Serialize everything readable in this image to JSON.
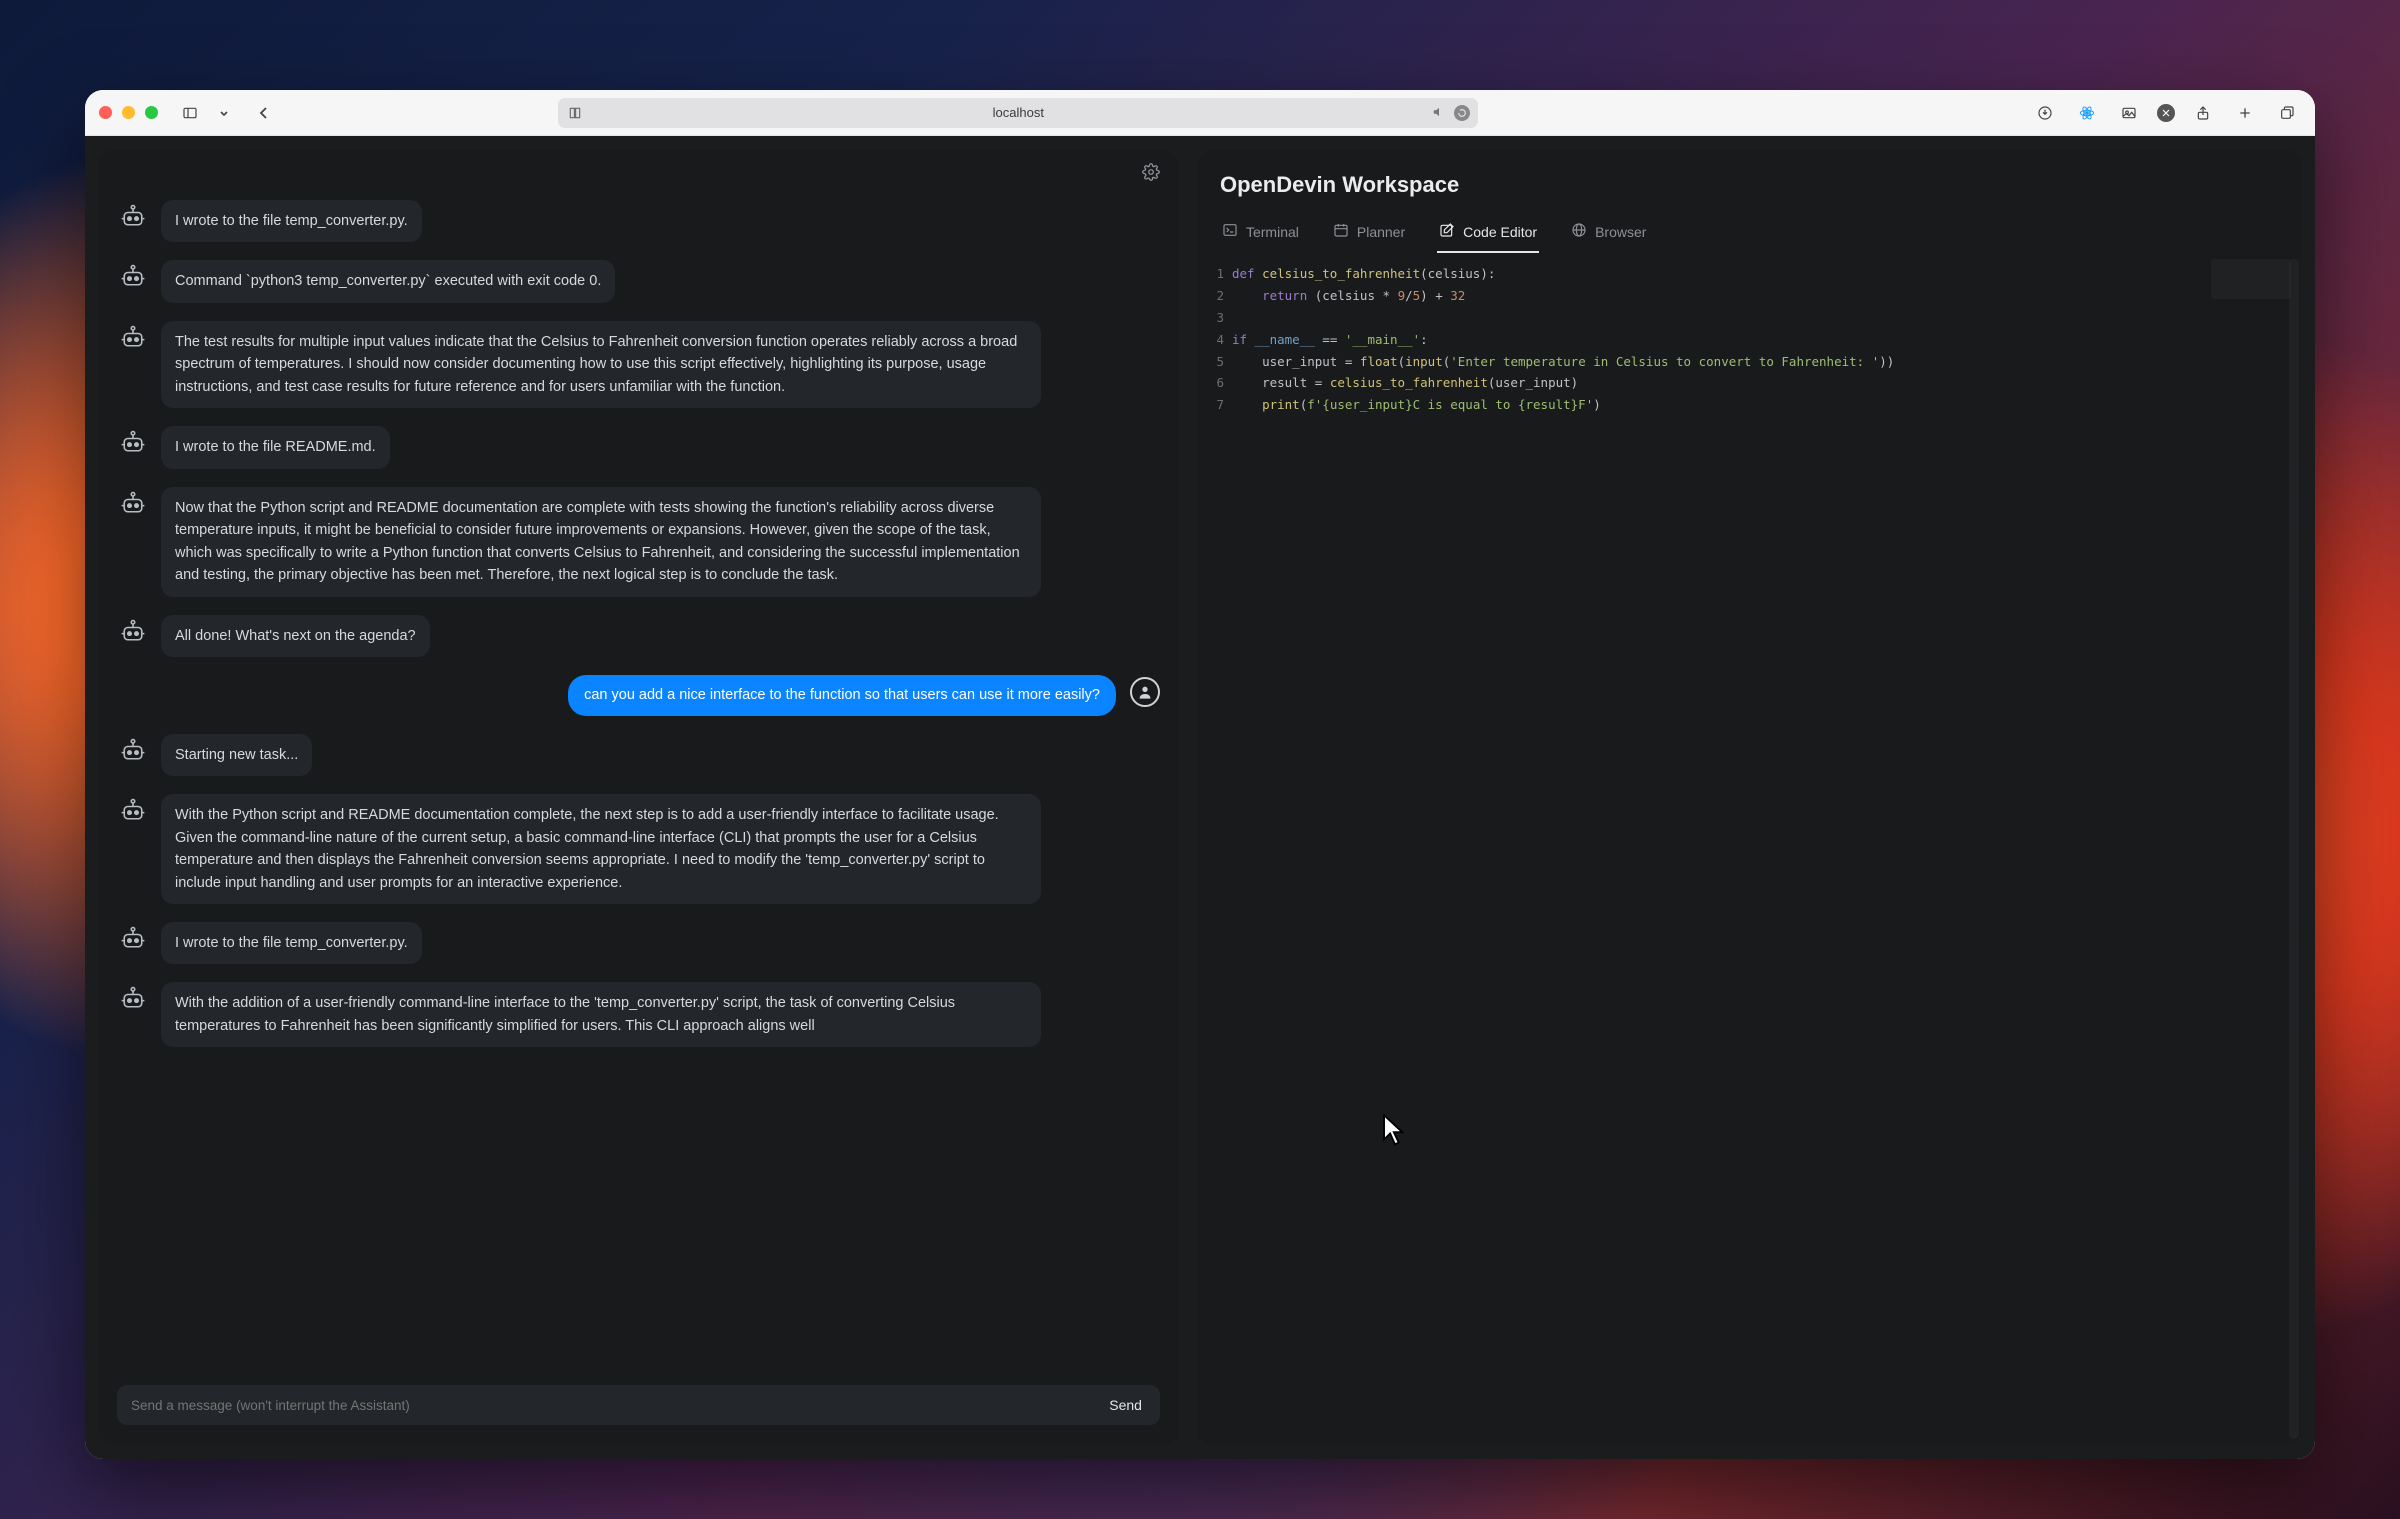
{
  "browser": {
    "url_label": "localhost"
  },
  "chat": {
    "messages": [
      {
        "role": "bot",
        "text": "I wrote to the file temp_converter.py."
      },
      {
        "role": "bot",
        "text": "Command `python3 temp_converter.py` executed with exit code 0."
      },
      {
        "role": "bot",
        "text": "The test results for multiple input values indicate that the Celsius to Fahrenheit conversion function operates reliably across a broad spectrum of temperatures. I should now consider documenting how to use this script effectively, highlighting its purpose, usage instructions, and test case results for future reference and for users unfamiliar with the function."
      },
      {
        "role": "bot",
        "text": "I wrote to the file README.md."
      },
      {
        "role": "bot",
        "text": "Now that the Python script and README documentation are complete with tests showing the function's reliability across diverse temperature inputs, it might be beneficial to consider future improvements or expansions. However, given the scope of the task, which was specifically to write a Python function that converts Celsius to Fahrenheit, and considering the successful implementation and testing, the primary objective has been met. Therefore, the next logical step is to conclude the task."
      },
      {
        "role": "bot",
        "text": "All done! What's next on the agenda?"
      },
      {
        "role": "user",
        "text": "can you add a nice interface to the function so that users can use it more easily?"
      },
      {
        "role": "bot",
        "text": "Starting new task..."
      },
      {
        "role": "bot",
        "text": "With the Python script and README documentation complete, the next step is to add a user-friendly interface to facilitate usage. Given the command-line nature of the current setup, a basic command-line interface (CLI) that prompts the user for a Celsius temperature and then displays the Fahrenheit conversion seems appropriate. I need to modify the 'temp_converter.py' script to include input handling and user prompts for an interactive experience."
      },
      {
        "role": "bot",
        "text": "I wrote to the file temp_converter.py."
      },
      {
        "role": "bot",
        "text": "With the addition of a user-friendly command-line interface to the 'temp_converter.py' script, the task of converting Celsius temperatures to Fahrenheit has been significantly simplified for users. This CLI approach aligns well"
      }
    ],
    "composer": {
      "placeholder": "Send a message (won't interrupt the Assistant)",
      "send_label": "Send"
    }
  },
  "workspace": {
    "title": "OpenDevin Workspace",
    "tabs": [
      {
        "id": "terminal",
        "label": "Terminal",
        "icon": "terminal",
        "active": false
      },
      {
        "id": "planner",
        "label": "Planner",
        "icon": "calendar",
        "active": false
      },
      {
        "id": "editor",
        "label": "Code Editor",
        "icon": "pencil-square",
        "active": true
      },
      {
        "id": "browser",
        "label": "Browser",
        "icon": "globe",
        "active": false
      }
    ],
    "code": {
      "line_numbers": [
        "1",
        "2",
        "3",
        "4",
        "5",
        "6",
        "7"
      ],
      "lines": [
        {
          "tokens": [
            {
              "t": "kw",
              "s": "def "
            },
            {
              "t": "fn",
              "s": "celsius_to_fahrenheit"
            },
            {
              "t": "op",
              "s": "(celsius):"
            }
          ]
        },
        {
          "indent": 1,
          "tokens": [
            {
              "t": "kw",
              "s": "return "
            },
            {
              "t": "op",
              "s": "(celsius * "
            },
            {
              "t": "num",
              "s": "9"
            },
            {
              "t": "op",
              "s": "/"
            },
            {
              "t": "num",
              "s": "5"
            },
            {
              "t": "op",
              "s": ") + "
            },
            {
              "t": "num",
              "s": "32"
            }
          ]
        },
        {
          "tokens": []
        },
        {
          "tokens": [
            {
              "t": "kw",
              "s": "if "
            },
            {
              "t": "sp",
              "s": "__name__"
            },
            {
              "t": "op",
              "s": " == "
            },
            {
              "t": "str",
              "s": "'__main__'"
            },
            {
              "t": "op",
              "s": ":"
            }
          ]
        },
        {
          "indent": 1,
          "tokens": [
            {
              "t": "op",
              "s": "user_input = "
            },
            {
              "t": "fn",
              "s": "float"
            },
            {
              "t": "op",
              "s": "("
            },
            {
              "t": "fn",
              "s": "input"
            },
            {
              "t": "op",
              "s": "("
            },
            {
              "t": "str",
              "s": "'Enter temperature in Celsius to convert to Fahrenheit: '"
            },
            {
              "t": "op",
              "s": "))"
            }
          ]
        },
        {
          "indent": 1,
          "tokens": [
            {
              "t": "op",
              "s": "result = "
            },
            {
              "t": "fn",
              "s": "celsius_to_fahrenheit"
            },
            {
              "t": "op",
              "s": "(user_input)"
            }
          ]
        },
        {
          "indent": 1,
          "tokens": [
            {
              "t": "fn",
              "s": "print"
            },
            {
              "t": "op",
              "s": "("
            },
            {
              "t": "str",
              "s": "f'{user_input}C is equal to {result}F'"
            },
            {
              "t": "op",
              "s": ")"
            }
          ]
        }
      ]
    }
  }
}
